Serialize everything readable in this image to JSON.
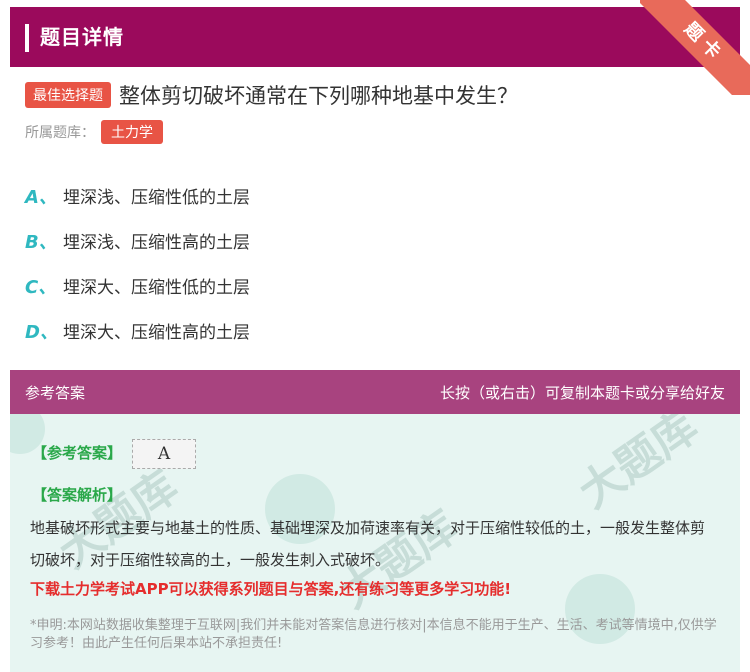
{
  "header": {
    "title": "题目详情"
  },
  "ribbon": {
    "label": "题卡"
  },
  "question": {
    "badge": "最佳选择题",
    "text": "整体剪切破坏通常在下列哪种地基中发生？",
    "bank_label": "所属题库：",
    "bank_tag": "土力学"
  },
  "options": [
    {
      "letter": "A、",
      "text": "埋深浅、压缩性低的土层"
    },
    {
      "letter": "B、",
      "text": "埋深浅、压缩性高的土层"
    },
    {
      "letter": "C、",
      "text": "埋深大、压缩性低的土层"
    },
    {
      "letter": "D、",
      "text": "埋深大、压缩性高的土层"
    }
  ],
  "answer_band": {
    "left": "参考答案",
    "right": "长按（或右击）可复制本题卡或分享给好友"
  },
  "answer": {
    "ref_label": "【参考答案】",
    "ref_value": "A",
    "analysis_label": "【答案解析】",
    "analysis_text": "地基破坏形式主要与地基土的性质、基础埋深及加荷速率有关，对于压缩性较低的土，一般发生整体剪切破坏，对于压缩性较高的土，一般发生刺入式破坏。",
    "promo": "下载土力学考试APP可以获得系列题目与答案,还有练习等更多学习功能!",
    "disclaimer": "*申明:本网站数据收集整理于互联网|我们并未能对答案信息进行核对|本信息不能用于生产、生活、考试等情境中,仅供学习参考！由此产生任何后果本站不承担责任!"
  },
  "colors": {
    "header_bg": "#9b0a5c",
    "answer_band_bg": "#a8437f",
    "badge_red": "#e85445",
    "option_letter": "#2fb8c0",
    "analysis_green": "#2aa84a",
    "promo_red": "#e52d2d",
    "panel_bg": "#e7f5f2"
  }
}
